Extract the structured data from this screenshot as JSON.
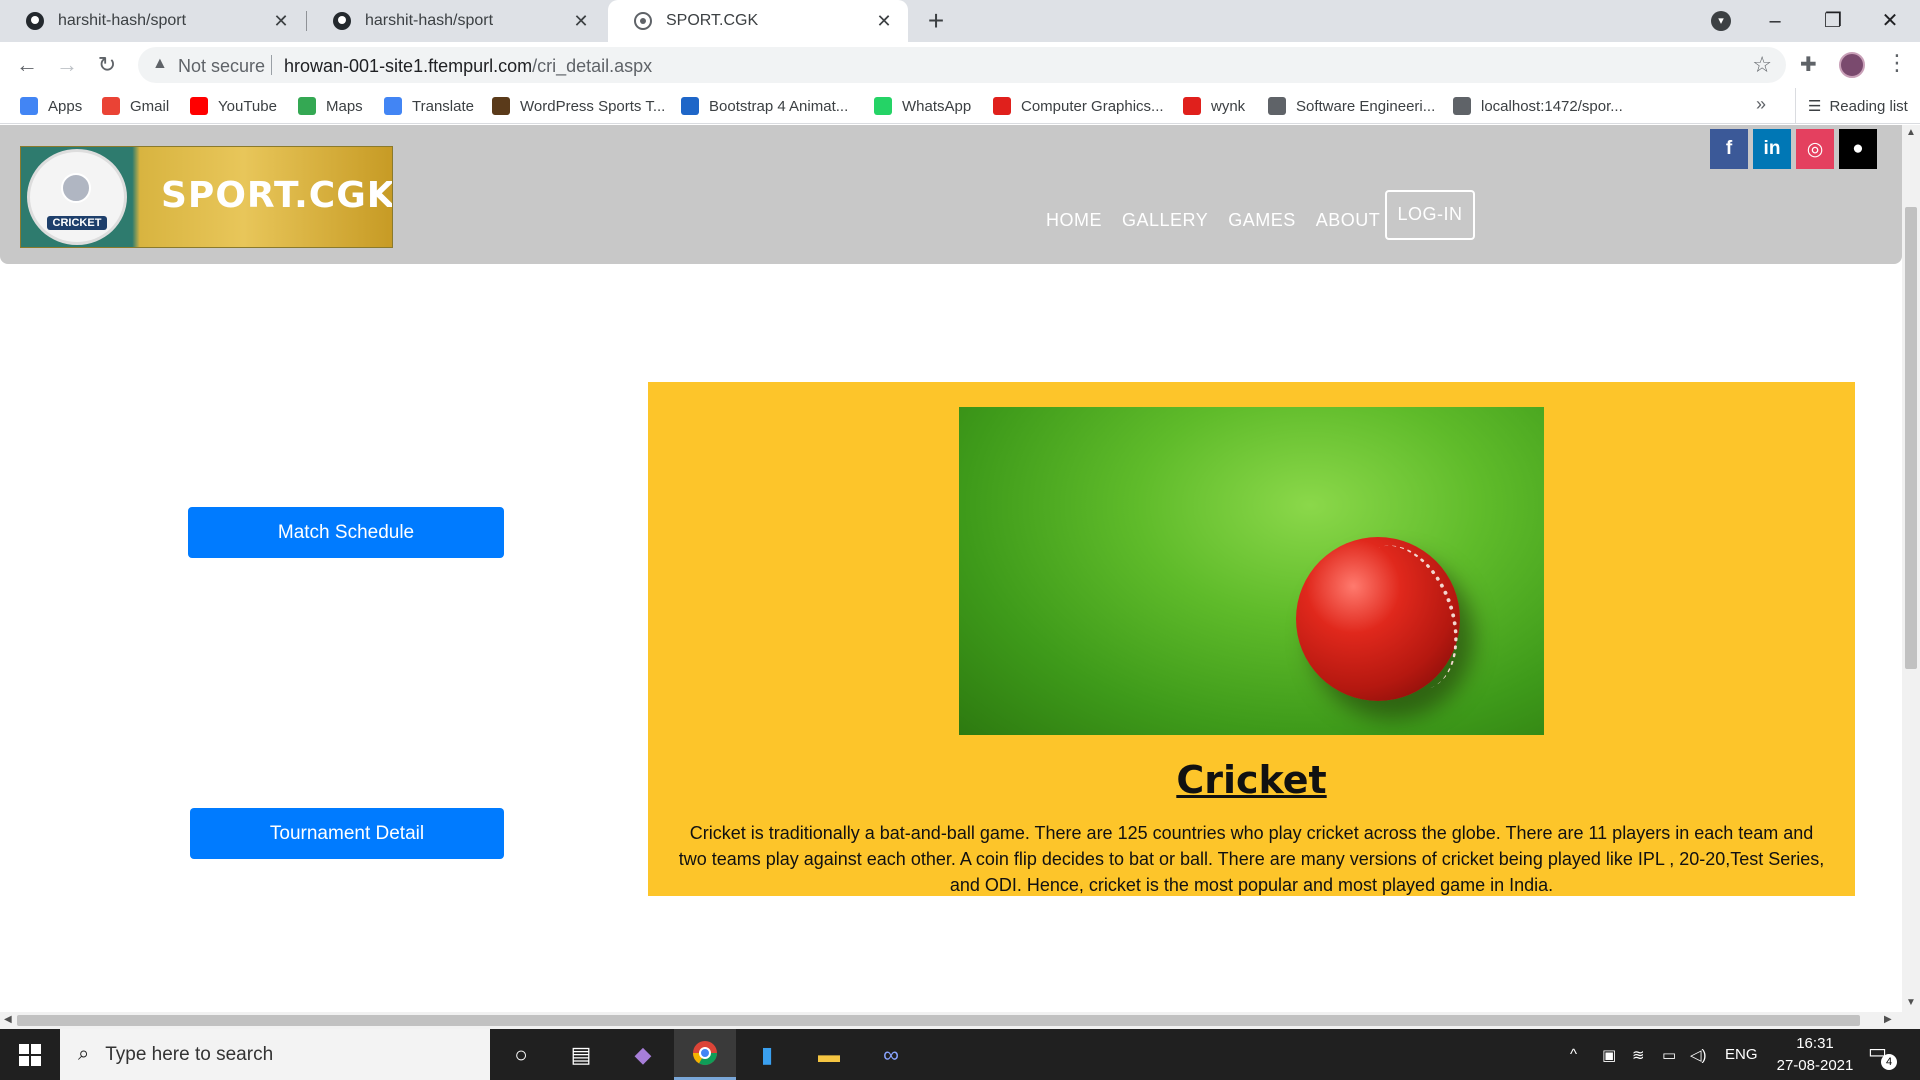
{
  "browser": {
    "tabs": [
      {
        "title": "harshit-hash/sport"
      },
      {
        "title": "harshit-hash/sport"
      },
      {
        "title": "SPORT.CGK"
      }
    ],
    "address": {
      "security": "Not secure",
      "host": "hrowan-001-site1.ftempurl.com",
      "path": "/cri_detail.aspx"
    },
    "bookmarks": [
      {
        "label": "Apps",
        "icon": "apps-grid-icon",
        "color": "#4285f4"
      },
      {
        "label": "Gmail",
        "icon": "gmail-icon",
        "color": "#ea4335"
      },
      {
        "label": "YouTube",
        "icon": "youtube-icon",
        "color": "#ff0000"
      },
      {
        "label": "Maps",
        "icon": "maps-icon",
        "color": "#34a853"
      },
      {
        "label": "Translate",
        "icon": "translate-icon",
        "color": "#4285f4"
      },
      {
        "label": "WordPress Sports T...",
        "icon": "wordpress-theme-icon",
        "color": "#5a3a1a"
      },
      {
        "label": "Bootstrap 4 Animat...",
        "icon": "bootstrap-icon",
        "color": "#1e66c8"
      },
      {
        "label": "WhatsApp",
        "icon": "whatsapp-icon",
        "color": "#25d366"
      },
      {
        "label": "Computer Graphics...",
        "icon": "computer-graphics-icon",
        "color": "#e0201c"
      },
      {
        "label": "wynk",
        "icon": "wynk-icon",
        "color": "#e0201c"
      },
      {
        "label": "Software Engineeri...",
        "icon": "globe-icon",
        "color": "#5f6368"
      },
      {
        "label": "localhost:1472/spor...",
        "icon": "globe-icon",
        "color": "#5f6368"
      }
    ],
    "reading_list": "Reading list"
  },
  "site": {
    "logo_text": "SPORT.CGK",
    "logo_badge": "CRICKET",
    "nav": [
      "HOME",
      "GALLERY",
      "GAMES",
      "ABOUT"
    ],
    "login": "LOG-IN",
    "social": [
      {
        "name": "facebook-icon",
        "glyph": "f",
        "color": "#3b5998"
      },
      {
        "name": "linkedin-icon",
        "glyph": "in",
        "color": "#0077b5"
      },
      {
        "name": "instagram-icon",
        "glyph": "◎",
        "color": "#e4405f"
      },
      {
        "name": "github-icon",
        "glyph": "●",
        "color": "#000000"
      }
    ],
    "side_buttons": {
      "match_schedule": "Match Schedule",
      "tournament_detail": "Tournament Detail"
    },
    "card": {
      "title": "Cricket",
      "text": "Cricket is traditionally a bat-and-ball game. There are 125 countries who play cricket across the globe. There are 11 players in each team and two teams play against each other. A coin flip decides to bat or ball. There are many versions of cricket being played like IPL , 20-20,Test Series, and ODI. Hence, cricket is the most popular and most played game in India."
    }
  },
  "taskbar": {
    "search_placeholder": "Type here to search",
    "language": "ENG",
    "time": "16:31",
    "date": "27-08-2021",
    "notification_count": "4"
  }
}
